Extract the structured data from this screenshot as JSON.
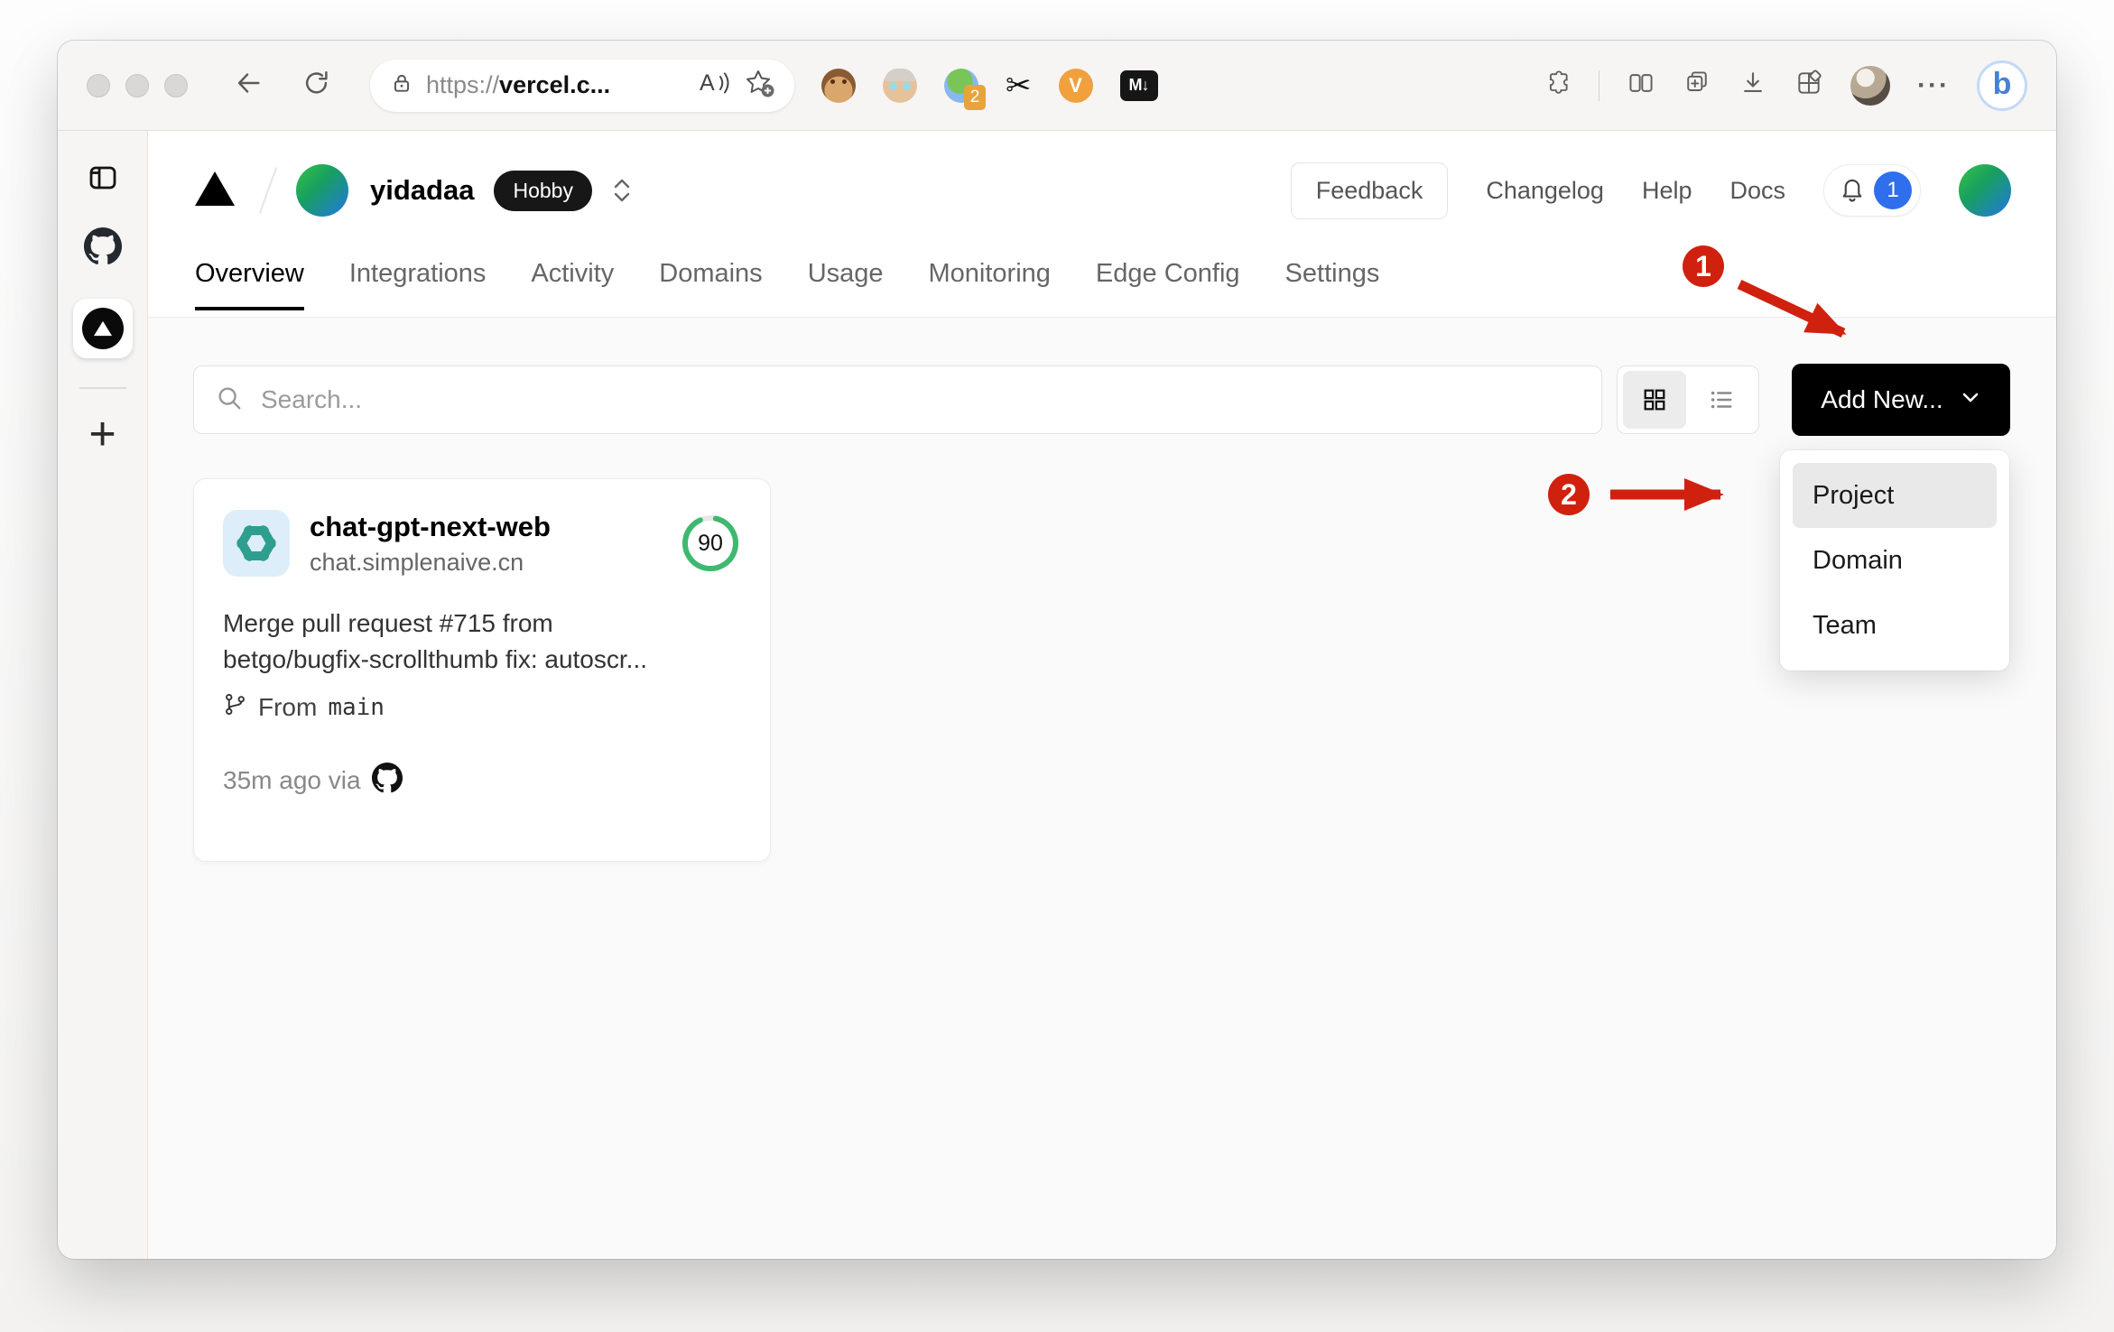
{
  "browser": {
    "url_protocol": "https://",
    "url_host": "vercel.c...",
    "ext_badge_count": "2",
    "ext_scissors_glyph": "✂",
    "ext_v_label": "V",
    "ext_markdown_label": "M↓",
    "menu_dots": "···",
    "bing_label": "b"
  },
  "vercel": {
    "team_name": "yidadaa",
    "plan_badge": "Hobby",
    "nav": {
      "feedback": "Feedback",
      "changelog": "Changelog",
      "help": "Help",
      "docs": "Docs",
      "notification_count": "1"
    },
    "tabs": [
      {
        "label": "Overview",
        "active": true
      },
      {
        "label": "Integrations",
        "active": false
      },
      {
        "label": "Activity",
        "active": false
      },
      {
        "label": "Domains",
        "active": false
      },
      {
        "label": "Usage",
        "active": false
      },
      {
        "label": "Monitoring",
        "active": false
      },
      {
        "label": "Edge Config",
        "active": false
      },
      {
        "label": "Settings",
        "active": false
      }
    ],
    "controls": {
      "search_placeholder": "Search...",
      "add_new_label": "Add New..."
    },
    "dropdown": {
      "items": [
        {
          "label": "Project",
          "highlighted": true
        },
        {
          "label": "Domain",
          "highlighted": false
        },
        {
          "label": "Team",
          "highlighted": false
        }
      ]
    },
    "project_card": {
      "name": "chat-gpt-next-web",
      "domain": "chat.simplenaive.cn",
      "score": "90",
      "commit_line1": "Merge pull request #715 from",
      "commit_line2": "betgo/bugfix-scrollthumb fix: autoscr...",
      "branch_prefix": "From",
      "branch_name": "main",
      "deploy_meta": "35m ago via"
    }
  },
  "annotations": {
    "step1": "1",
    "step2": "2"
  },
  "colors": {
    "annotation_red": "#d0210f",
    "score_green": "#3eb96f",
    "badge_blue": "#2f6fed",
    "openai_teal": "#2f9e8e",
    "accent_black": "#000000"
  }
}
